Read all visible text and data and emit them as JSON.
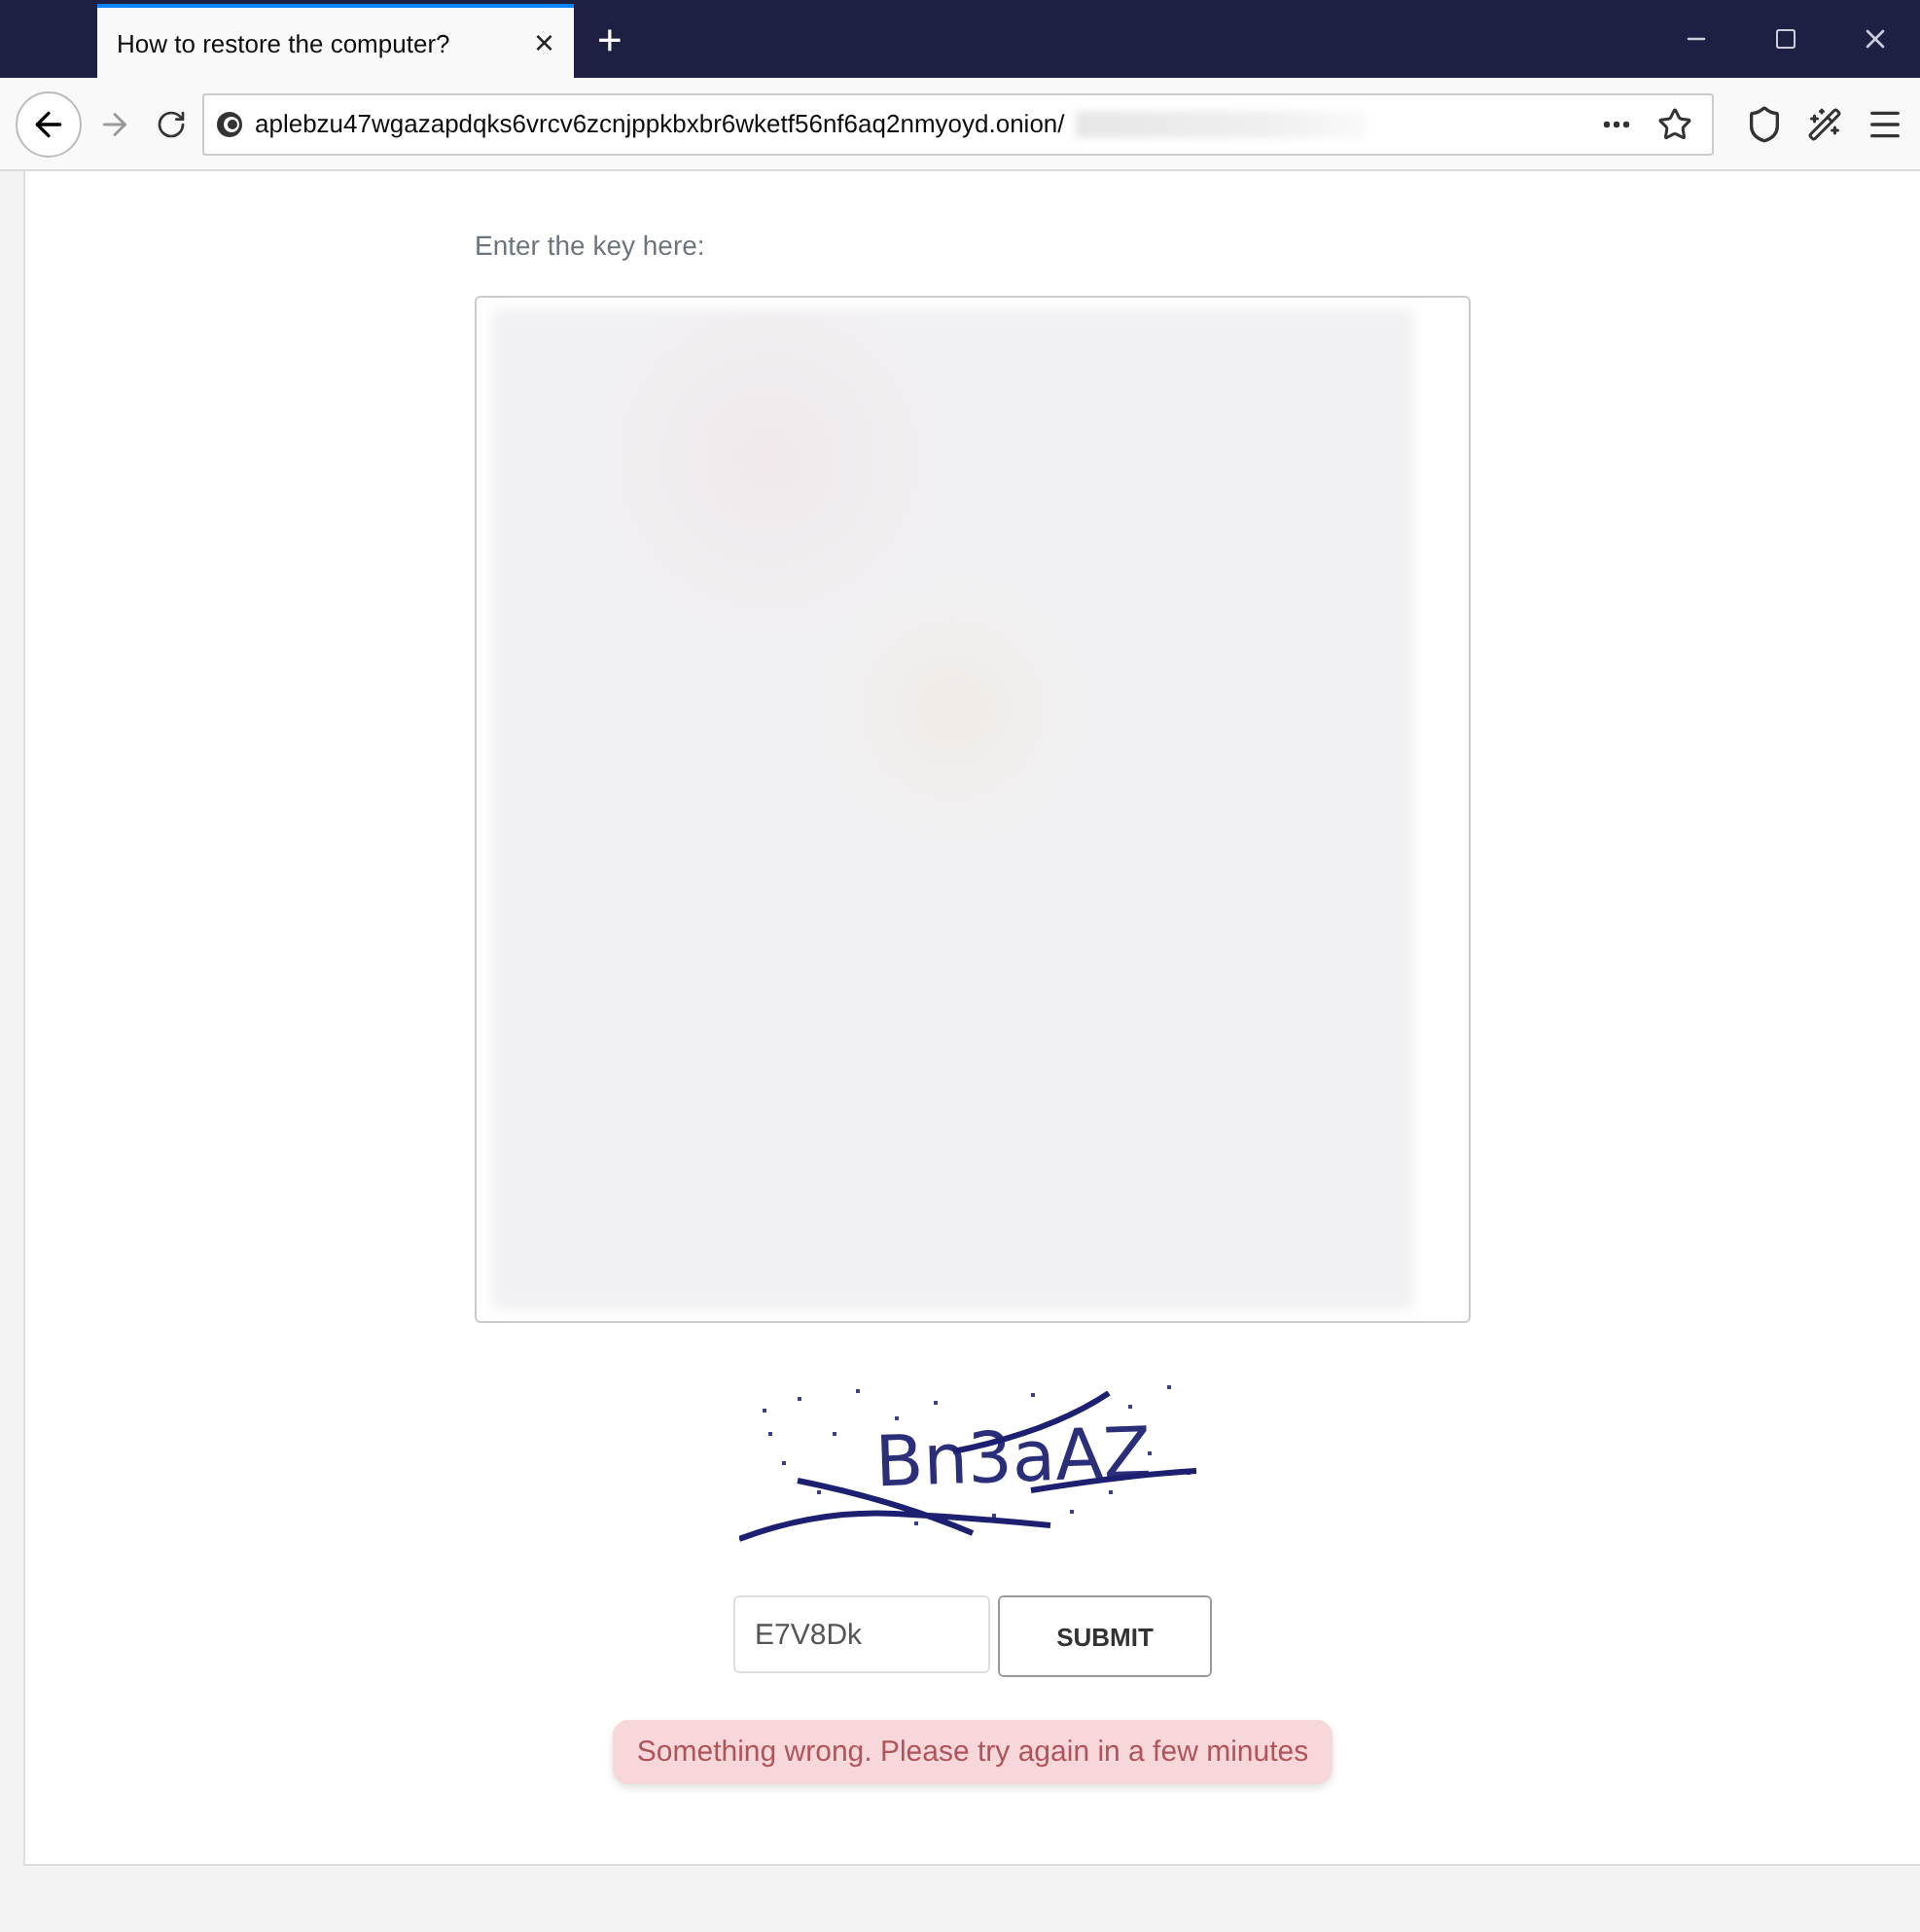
{
  "browser": {
    "tab": {
      "title": "How to restore the computer?",
      "close": "×"
    },
    "new_tab": "+",
    "address": "aplebzu47wgazapdqks6vrcv6zcnjppkbxbr6wketf56nf6aq2nmyoyd.onion/",
    "address_blurred": true
  },
  "page": {
    "key_label": "Enter the key here:",
    "key_blurred": true,
    "captcha": "Bn3aAZ",
    "captcha_field": {
      "value": "E7V8Dk"
    },
    "submit": "SUBMIT",
    "error": "Something wrong. Please try again in a few minutes"
  }
}
